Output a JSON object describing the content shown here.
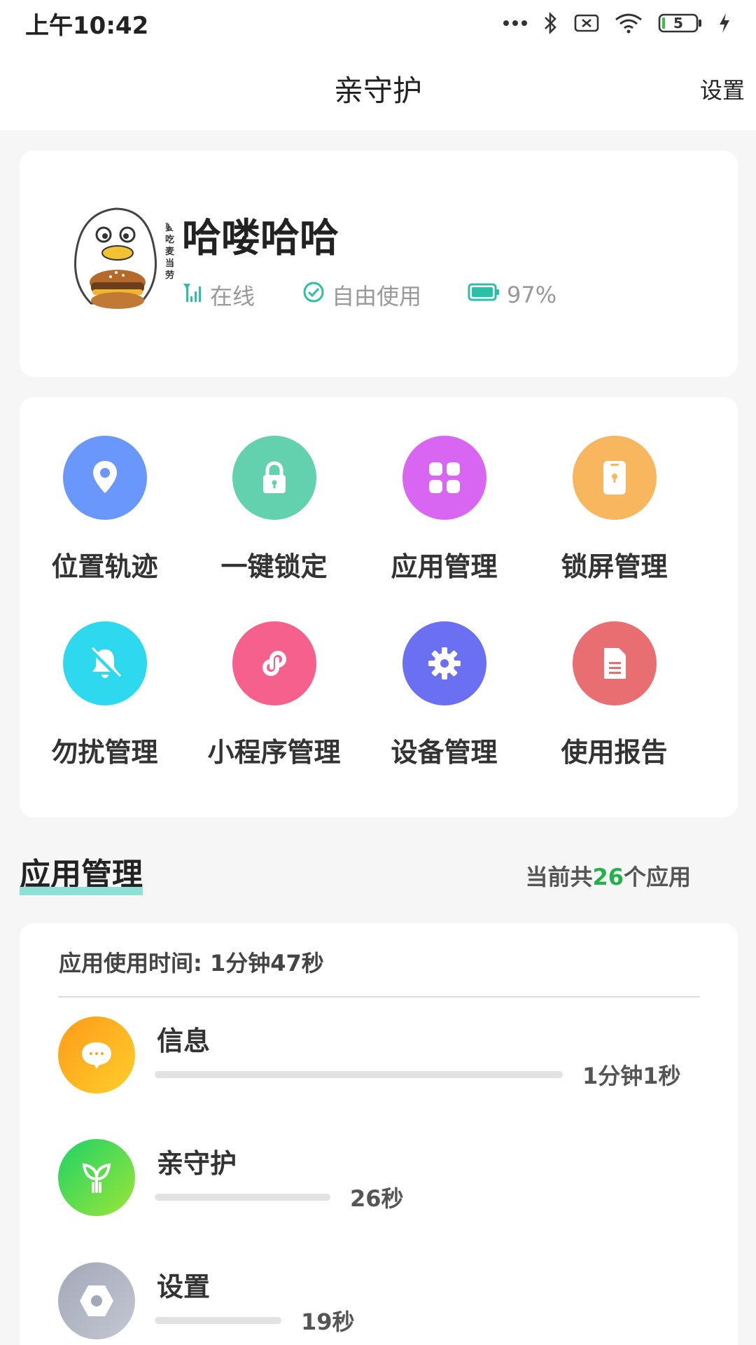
{
  "status_bar": {
    "time": "上午10:42",
    "battery_level": "5",
    "icons": [
      "more-dots-icon",
      "bluetooth-icon",
      "sim-disabled-icon",
      "wifi-icon",
      "battery-icon",
      "charging-icon"
    ]
  },
  "header": {
    "title": "亲守护",
    "settings_label": "设置"
  },
  "profile": {
    "name": "哈喽哈哈",
    "status_online": "在线",
    "status_mode": "自由使用",
    "battery": "97%",
    "avatar_caption": "要吃麦当劳"
  },
  "features": [
    {
      "label": "位置轨迹",
      "icon": "location-pin-icon",
      "color": "#6a97fb"
    },
    {
      "label": "一键锁定",
      "icon": "lock-icon",
      "color": "#63d1ad"
    },
    {
      "label": "应用管理",
      "icon": "apps-grid-icon",
      "color": "#d866f2"
    },
    {
      "label": "锁屏管理",
      "icon": "phone-lock-icon",
      "color": "#f8b65f"
    },
    {
      "label": "勿扰管理",
      "icon": "bell-off-icon",
      "color": "#2ed9ef"
    },
    {
      "label": "小程序管理",
      "icon": "mini-program-icon",
      "color": "#f5608c"
    },
    {
      "label": "设备管理",
      "icon": "gear-icon",
      "color": "#6b70f2"
    },
    {
      "label": "使用报告",
      "icon": "document-icon",
      "color": "#e86e71"
    }
  ],
  "app_section": {
    "title": "应用管理",
    "count_prefix": "当前共",
    "count": "26",
    "count_suffix": "个应用"
  },
  "usage": {
    "total_label": "应用使用时间: 1分钟47秒",
    "apps": [
      {
        "name": "信息",
        "time": "1分钟1秒",
        "share": 1.0,
        "icon": "message-icon"
      },
      {
        "name": "亲守护",
        "time": "26秒",
        "share": 0.43,
        "icon": "sprout-icon"
      },
      {
        "name": "设置",
        "time": "19秒",
        "share": 0.31,
        "icon": "hex-nut-icon"
      }
    ]
  }
}
